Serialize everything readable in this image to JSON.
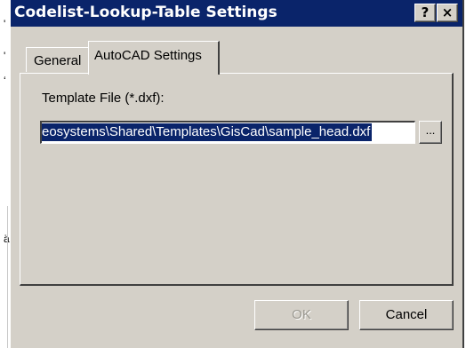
{
  "background": {
    "fragments": [
      "'",
      "'",
      "ʻ",
      "ä"
    ]
  },
  "dialog": {
    "title": "Codelist-Lookup-Table Settings",
    "help_glyph": "?",
    "close_glyph": "×",
    "tabs": [
      {
        "label": "General",
        "active": false
      },
      {
        "label": "AutoCAD Settings",
        "active": true
      }
    ],
    "template_label": "Template File (*.dxf):",
    "template_value": "eosystems\\Shared\\Templates\\GisCad\\sample_head.dxf",
    "browse_label": "...",
    "ok_label": "OK",
    "ok_enabled": false,
    "cancel_label": "Cancel"
  },
  "colors": {
    "titlebar": "#0a246a",
    "face": "#d4d0c8",
    "selection": "#0a246a"
  }
}
